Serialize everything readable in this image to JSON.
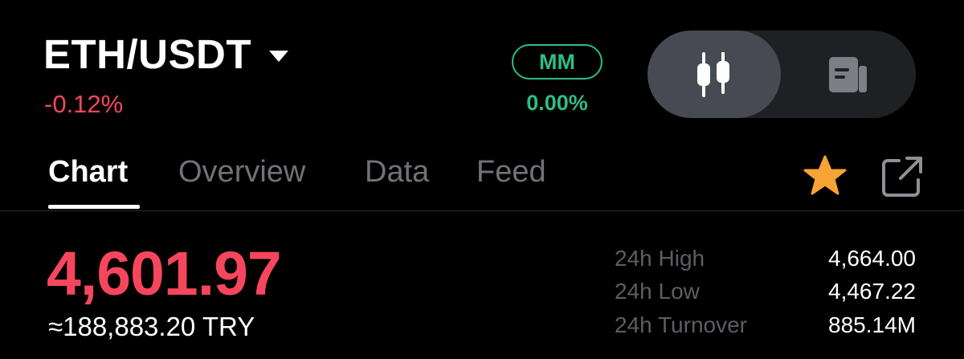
{
  "header": {
    "pair": "ETH/USDT",
    "change_percent": "-0.12%",
    "mm_badge": "MM",
    "mm_value": "0.00%"
  },
  "tabs": [
    {
      "label": "Chart",
      "active": true
    },
    {
      "label": "Overview",
      "active": false
    },
    {
      "label": "Data",
      "active": false
    },
    {
      "label": "Feed",
      "active": false
    }
  ],
  "toggle": {
    "options": [
      "candlestick-chart-icon",
      "order-book-icon"
    ],
    "selected": "candlestick-chart-icon"
  },
  "actions": {
    "favorite_icon": "star-icon",
    "favorite_color": "#f7a335",
    "share_icon": "external-link-icon"
  },
  "price": {
    "last": "4,601.97",
    "converted": "≈188,883.20 TRY"
  },
  "stats": [
    {
      "label": "24h High",
      "value": "4,664.00"
    },
    {
      "label": "24h Low",
      "value": "4,467.22"
    },
    {
      "label": "24h Turnover",
      "value": "885.14M"
    }
  ],
  "colors": {
    "negative": "#f6465d",
    "positive": "#2ebd85",
    "background": "#000000"
  }
}
